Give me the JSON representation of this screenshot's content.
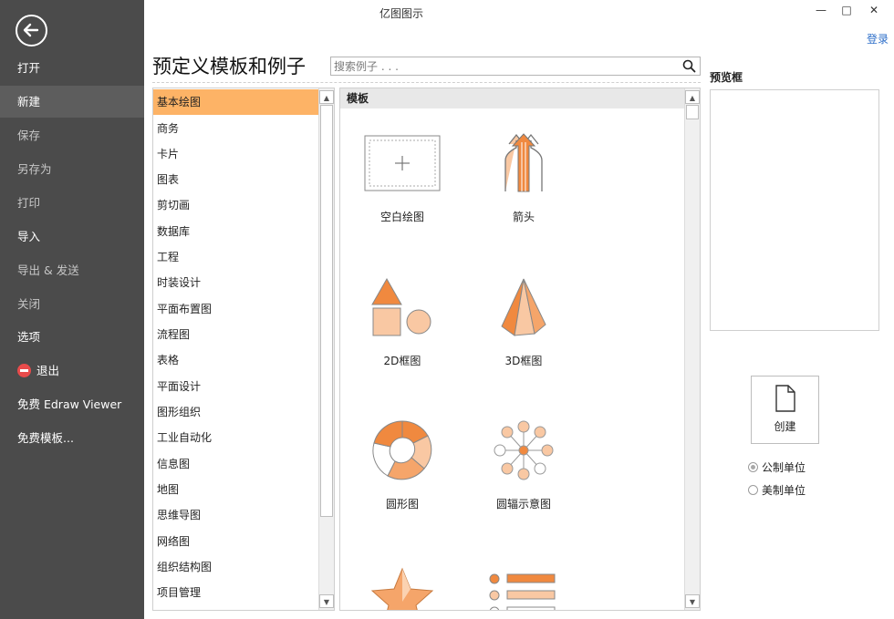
{
  "window": {
    "title": "亿图图示",
    "minimize": "—",
    "maximize": "□",
    "close": "✕",
    "login": "登录"
  },
  "nav": {
    "items": [
      {
        "label": "打开"
      },
      {
        "label": "新建"
      },
      {
        "label": "保存"
      },
      {
        "label": "另存为"
      },
      {
        "label": "打印"
      },
      {
        "label": "导入"
      },
      {
        "label": "导出 & 发送"
      },
      {
        "label": "关闭"
      },
      {
        "label": "选项"
      },
      {
        "label": "退出"
      },
      {
        "label": "免费 Edraw Viewer"
      },
      {
        "label": "免费模板..."
      }
    ],
    "active": "新建"
  },
  "main": {
    "heading": "预定义模板和例子",
    "search_placeholder": "搜索例子 . . ."
  },
  "categories": {
    "items": [
      "基本绘图",
      "商务",
      "卡片",
      "图表",
      "剪切画",
      "数据库",
      "工程",
      "时装设计",
      "平面布置图",
      "流程图",
      "表格",
      "平面设计",
      "图形组织",
      "工业自动化",
      "信息图",
      "地图",
      "思维导图",
      "网络图",
      "组织结构图",
      "项目管理"
    ],
    "selected": "基本绘图"
  },
  "templates": {
    "header": "模板",
    "tiles": [
      {
        "label": "空白绘图",
        "icon": "blank-drawing-icon"
      },
      {
        "label": "箭头",
        "icon": "arrows-icon"
      },
      {
        "label": "2D框图",
        "icon": "2d-shapes-icon"
      },
      {
        "label": "3D框图",
        "icon": "3d-pyramid-icon"
      },
      {
        "label": "圆形图",
        "icon": "circular-diagram-icon"
      },
      {
        "label": "圆辐示意图",
        "icon": "radial-diagram-icon"
      },
      {
        "label": "",
        "icon": "star-icon"
      },
      {
        "label": "",
        "icon": "list-icon"
      }
    ]
  },
  "right": {
    "preview_label": "预览框",
    "create_label": "创建",
    "units": [
      {
        "label": "公制单位",
        "checked": true
      },
      {
        "label": "美制单位",
        "checked": false
      }
    ]
  },
  "colors": {
    "accent": "#fdb366",
    "orange": "#f0893f",
    "peach": "#f9c8a3",
    "nav_bg": "#4b4b4b"
  }
}
